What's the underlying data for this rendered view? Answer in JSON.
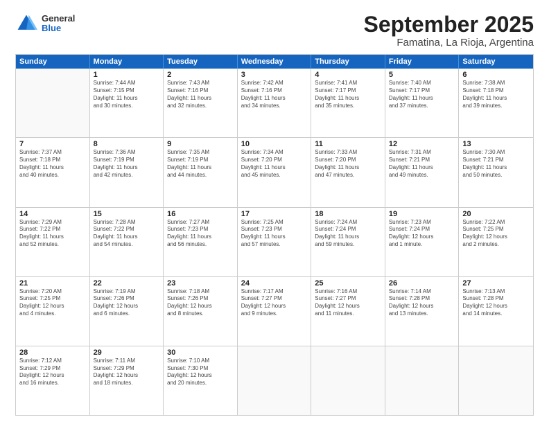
{
  "header": {
    "logo": {
      "general": "General",
      "blue": "Blue"
    },
    "title": "September 2025",
    "subtitle": "Famatina, La Rioja, Argentina"
  },
  "days": [
    "Sunday",
    "Monday",
    "Tuesday",
    "Wednesday",
    "Thursday",
    "Friday",
    "Saturday"
  ],
  "weeks": [
    [
      {
        "day": "",
        "text": ""
      },
      {
        "day": "1",
        "text": "Sunrise: 7:44 AM\nSunset: 7:15 PM\nDaylight: 11 hours\nand 30 minutes."
      },
      {
        "day": "2",
        "text": "Sunrise: 7:43 AM\nSunset: 7:16 PM\nDaylight: 11 hours\nand 32 minutes."
      },
      {
        "day": "3",
        "text": "Sunrise: 7:42 AM\nSunset: 7:16 PM\nDaylight: 11 hours\nand 34 minutes."
      },
      {
        "day": "4",
        "text": "Sunrise: 7:41 AM\nSunset: 7:17 PM\nDaylight: 11 hours\nand 35 minutes."
      },
      {
        "day": "5",
        "text": "Sunrise: 7:40 AM\nSunset: 7:17 PM\nDaylight: 11 hours\nand 37 minutes."
      },
      {
        "day": "6",
        "text": "Sunrise: 7:38 AM\nSunset: 7:18 PM\nDaylight: 11 hours\nand 39 minutes."
      }
    ],
    [
      {
        "day": "7",
        "text": "Sunrise: 7:37 AM\nSunset: 7:18 PM\nDaylight: 11 hours\nand 40 minutes."
      },
      {
        "day": "8",
        "text": "Sunrise: 7:36 AM\nSunset: 7:19 PM\nDaylight: 11 hours\nand 42 minutes."
      },
      {
        "day": "9",
        "text": "Sunrise: 7:35 AM\nSunset: 7:19 PM\nDaylight: 11 hours\nand 44 minutes."
      },
      {
        "day": "10",
        "text": "Sunrise: 7:34 AM\nSunset: 7:20 PM\nDaylight: 11 hours\nand 45 minutes."
      },
      {
        "day": "11",
        "text": "Sunrise: 7:33 AM\nSunset: 7:20 PM\nDaylight: 11 hours\nand 47 minutes."
      },
      {
        "day": "12",
        "text": "Sunrise: 7:31 AM\nSunset: 7:21 PM\nDaylight: 11 hours\nand 49 minutes."
      },
      {
        "day": "13",
        "text": "Sunrise: 7:30 AM\nSunset: 7:21 PM\nDaylight: 11 hours\nand 50 minutes."
      }
    ],
    [
      {
        "day": "14",
        "text": "Sunrise: 7:29 AM\nSunset: 7:22 PM\nDaylight: 11 hours\nand 52 minutes."
      },
      {
        "day": "15",
        "text": "Sunrise: 7:28 AM\nSunset: 7:22 PM\nDaylight: 11 hours\nand 54 minutes."
      },
      {
        "day": "16",
        "text": "Sunrise: 7:27 AM\nSunset: 7:23 PM\nDaylight: 11 hours\nand 56 minutes."
      },
      {
        "day": "17",
        "text": "Sunrise: 7:25 AM\nSunset: 7:23 PM\nDaylight: 11 hours\nand 57 minutes."
      },
      {
        "day": "18",
        "text": "Sunrise: 7:24 AM\nSunset: 7:24 PM\nDaylight: 11 hours\nand 59 minutes."
      },
      {
        "day": "19",
        "text": "Sunrise: 7:23 AM\nSunset: 7:24 PM\nDaylight: 12 hours\nand 1 minute."
      },
      {
        "day": "20",
        "text": "Sunrise: 7:22 AM\nSunset: 7:25 PM\nDaylight: 12 hours\nand 2 minutes."
      }
    ],
    [
      {
        "day": "21",
        "text": "Sunrise: 7:20 AM\nSunset: 7:25 PM\nDaylight: 12 hours\nand 4 minutes."
      },
      {
        "day": "22",
        "text": "Sunrise: 7:19 AM\nSunset: 7:26 PM\nDaylight: 12 hours\nand 6 minutes."
      },
      {
        "day": "23",
        "text": "Sunrise: 7:18 AM\nSunset: 7:26 PM\nDaylight: 12 hours\nand 8 minutes."
      },
      {
        "day": "24",
        "text": "Sunrise: 7:17 AM\nSunset: 7:27 PM\nDaylight: 12 hours\nand 9 minutes."
      },
      {
        "day": "25",
        "text": "Sunrise: 7:16 AM\nSunset: 7:27 PM\nDaylight: 12 hours\nand 11 minutes."
      },
      {
        "day": "26",
        "text": "Sunrise: 7:14 AM\nSunset: 7:28 PM\nDaylight: 12 hours\nand 13 minutes."
      },
      {
        "day": "27",
        "text": "Sunrise: 7:13 AM\nSunset: 7:28 PM\nDaylight: 12 hours\nand 14 minutes."
      }
    ],
    [
      {
        "day": "28",
        "text": "Sunrise: 7:12 AM\nSunset: 7:29 PM\nDaylight: 12 hours\nand 16 minutes."
      },
      {
        "day": "29",
        "text": "Sunrise: 7:11 AM\nSunset: 7:29 PM\nDaylight: 12 hours\nand 18 minutes."
      },
      {
        "day": "30",
        "text": "Sunrise: 7:10 AM\nSunset: 7:30 PM\nDaylight: 12 hours\nand 20 minutes."
      },
      {
        "day": "",
        "text": ""
      },
      {
        "day": "",
        "text": ""
      },
      {
        "day": "",
        "text": ""
      },
      {
        "day": "",
        "text": ""
      }
    ]
  ]
}
